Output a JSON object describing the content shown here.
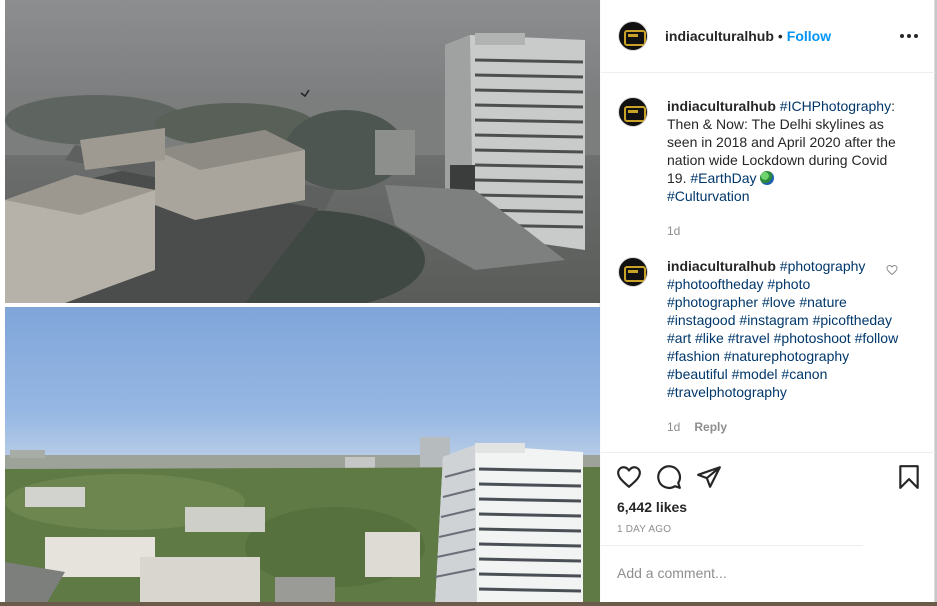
{
  "post": {
    "images": [
      {
        "name": "delhi-skyline-2018",
        "sky_color": "#8a8c8d"
      },
      {
        "name": "delhi-skyline-2020",
        "sky_color": "#8fb2e2"
      }
    ]
  },
  "header": {
    "username": "indiaculturalhub",
    "separator": "•",
    "follow_label": "Follow",
    "more_icon": "more-horizontal-icon"
  },
  "caption": {
    "username": "indiaculturalhub",
    "hashtag1": "#ICHPhotography",
    "text": ": Then & Now: The Delhi skylines as seen in 2018 and April 2020 after the nation wide Lockdown during Covid 19. ",
    "hashtag2": "#EarthDay",
    "emoji": "globe-emoji",
    "hashtag3": "#Culturvation",
    "time": "1d"
  },
  "comment": {
    "username": "indiaculturalhub",
    "hashtags": [
      "#photography",
      "#photooftheday",
      "#photo",
      "#photographer",
      "#love",
      "#nature",
      "#instagood",
      "#instagram",
      "#picoftheday",
      "#art",
      "#like",
      "#travel",
      "#photoshoot",
      "#follow",
      "#fashion",
      "#naturephotography",
      "#beautiful",
      "#model",
      "#canon",
      "#travelphotography"
    ],
    "time": "1d",
    "reply_label": "Reply"
  },
  "actions": {
    "icons": [
      "heart-icon",
      "comment-icon",
      "share-icon",
      "bookmark-icon"
    ],
    "likes": "6,442 likes",
    "date": "1 DAY AGO"
  },
  "add_comment": {
    "placeholder": "Add a comment..."
  },
  "colors": {
    "link_blue": "#0095f6",
    "hashtag": "#00376b",
    "muted": "#8e8e8e",
    "text": "#262626"
  }
}
